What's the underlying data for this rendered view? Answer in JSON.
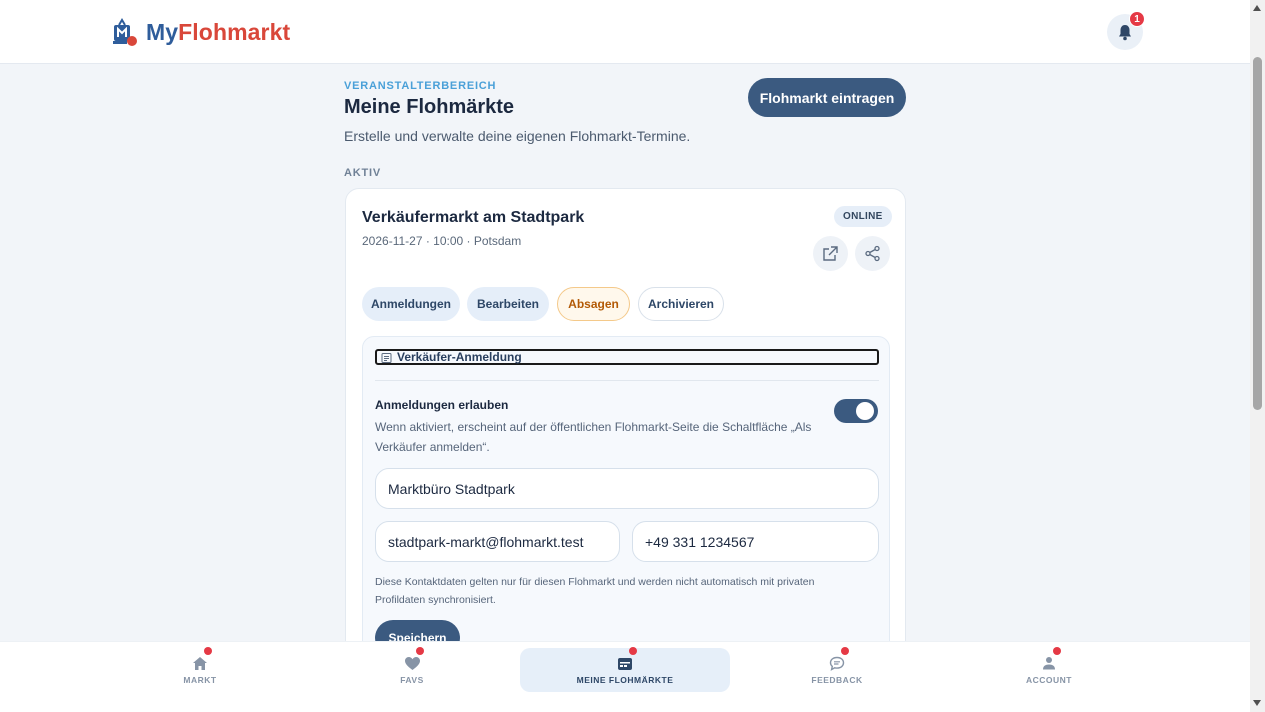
{
  "header": {
    "logo_text_my": "My",
    "logo_text_flohmarkt": "Flohmarkt",
    "notification_count": "1"
  },
  "page": {
    "eyebrow": "VERANSTALTERBEREICH",
    "title": "Meine Flohmärkte",
    "subtitle": "Erstelle und verwalte deine eigenen Flohmarkt-Termine.",
    "cta_label": "Flohmarkt eintragen",
    "section_label": "AKTIV"
  },
  "market_card": {
    "title": "Verkäufermarkt am Stadtpark",
    "meta": "2026-11-27 · 10:00 · Potsdam",
    "status": "ONLINE",
    "actions": {
      "registrations": "Anmeldungen",
      "edit": "Bearbeiten",
      "cancel": "Absagen",
      "archive": "Archivieren"
    },
    "panel": {
      "heading": "Verkäufer-Anmeldung",
      "toggle_label": "Anmeldungen erlauben",
      "toggle_description": "Wenn aktiviert, erscheint auf der öffentlichen Flohmarkt-Seite die Schaltfläche „Als Verkäufer anmelden“.",
      "toggle_on": true,
      "contact_name": "Marktbüro Stadtpark",
      "contact_email": "stadtpark-markt@flohmarkt.test",
      "contact_phone": "+49 331 1234567",
      "hint": "Diese Kontaktdaten gelten nur für diesen Flohmarkt und werden nicht automatisch mit privaten Profildaten synchronisiert.",
      "save_label": "Speichern"
    }
  },
  "bottom_nav": {
    "market": "MARKT",
    "favs": "FAVS",
    "my_markets": "MEINE FLOHMÄRKTE",
    "feedback": "FEEDBACK",
    "account": "ACCOUNT"
  },
  "colors": {
    "primary": "#3b5a80",
    "accent_blue": "#4aa0d8",
    "brand_red": "#d9473a",
    "notification_red": "#e53945",
    "cancel_orange": "#b35a06"
  }
}
